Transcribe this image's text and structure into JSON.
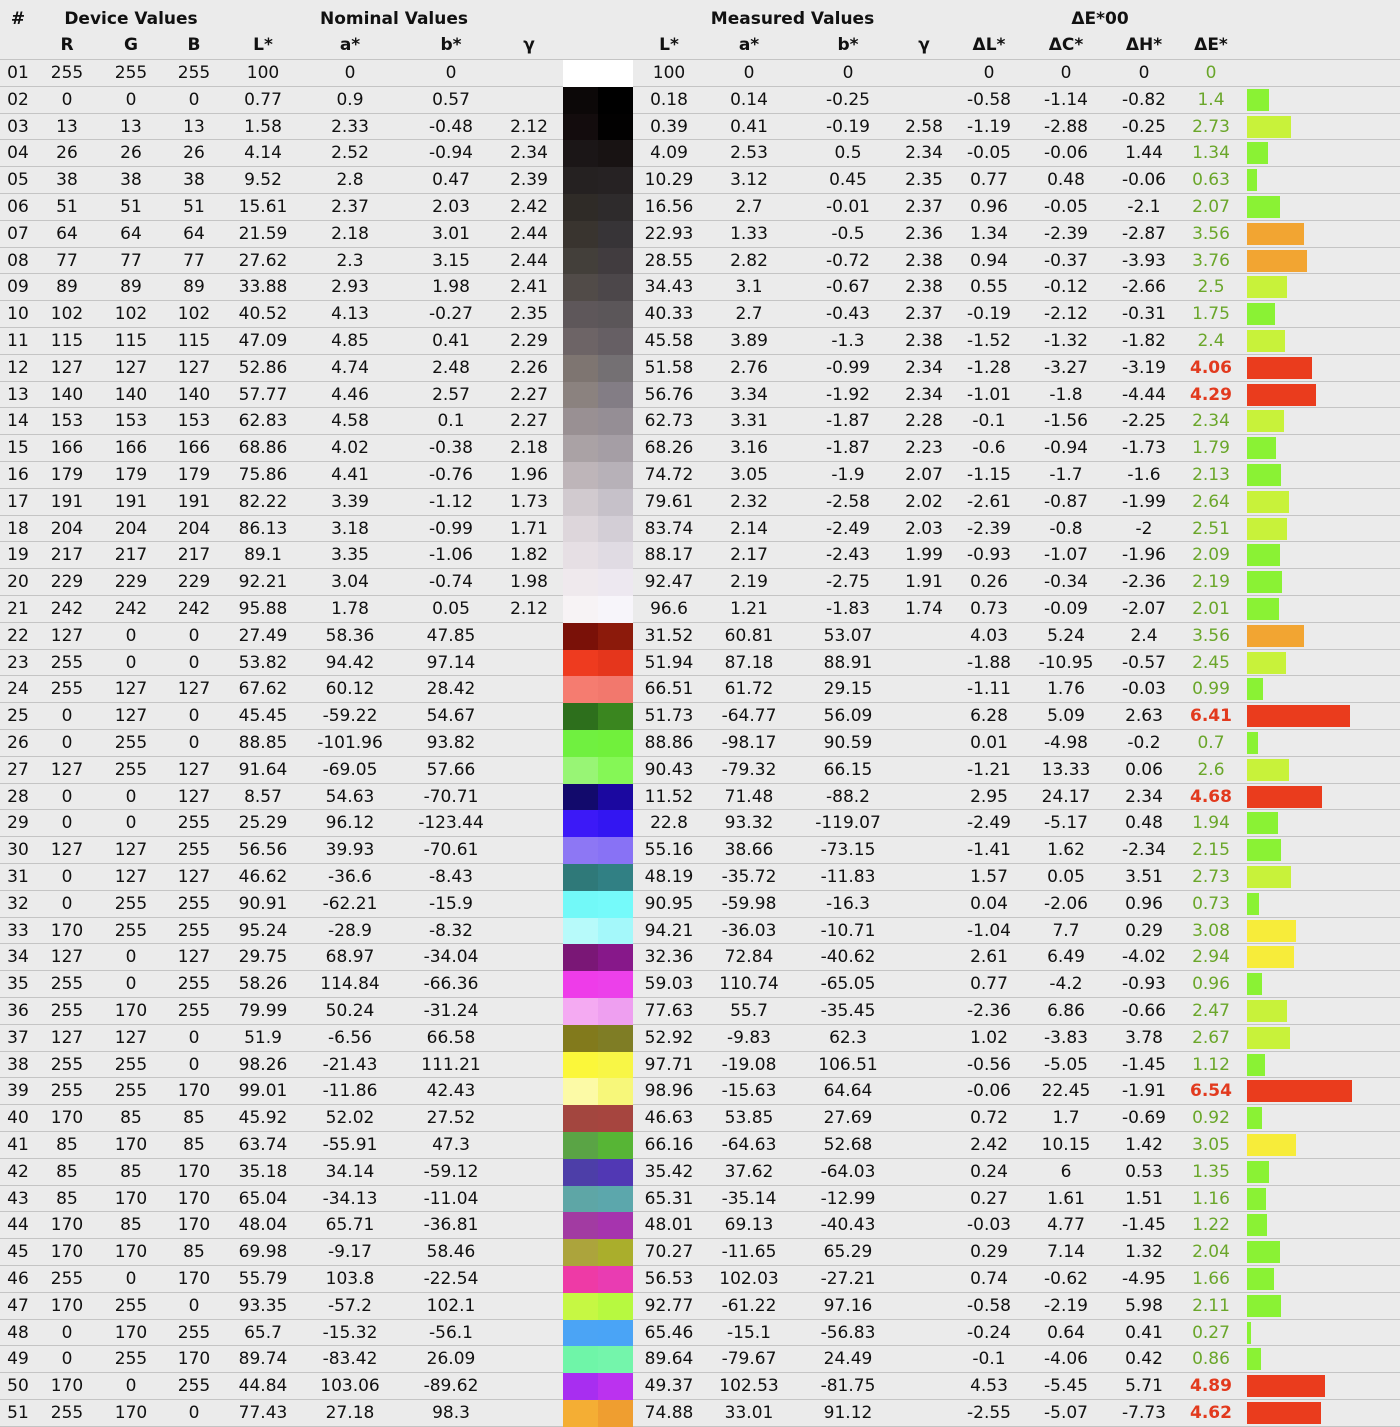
{
  "header": {
    "group_row": [
      "#",
      "Device Values",
      "Nominal Values",
      "Measured Values",
      "ΔE*00"
    ],
    "columns": [
      "R",
      "G",
      "B",
      "L*",
      "a*",
      "b*",
      "γ",
      "L*",
      "a*",
      "b*",
      "γ",
      "ΔL*",
      "ΔC*",
      "ΔH*",
      "ΔE*"
    ]
  },
  "colors": {
    "de_good": "#6aa62a",
    "de_bad": "#e23a1e",
    "bar_green": "#8af234",
    "bar_lime": "#c8f23a",
    "bar_yellow": "#f7ec3a",
    "bar_orange": "#f2a532",
    "bar_red": "#ea3c1d"
  },
  "rows": [
    {
      "id": "01",
      "r": "255",
      "g": "255",
      "b": "255",
      "nl": "100",
      "na": "0",
      "nb": "0",
      "ng": "",
      "ml": "100",
      "ma": "0",
      "mb": "0",
      "mg": "",
      "dl": "0",
      "dc": "0",
      "dh": "0",
      "de": "0",
      "sa": "#ffffff",
      "sb": "#ffffff"
    },
    {
      "id": "02",
      "r": "0",
      "g": "0",
      "b": "0",
      "nl": "0.77",
      "na": "0.9",
      "nb": "0.57",
      "ng": "",
      "ml": "0.18",
      "ma": "0.14",
      "mb": "-0.25",
      "mg": "",
      "dl": "-0.58",
      "dc": "-1.14",
      "dh": "-0.82",
      "de": "1.4",
      "sa": "#0c0808",
      "sb": "#000000"
    },
    {
      "id": "03",
      "r": "13",
      "g": "13",
      "b": "13",
      "nl": "1.58",
      "na": "2.33",
      "nb": "-0.48",
      "ng": "2.12",
      "ml": "0.39",
      "ma": "0.41",
      "mb": "-0.19",
      "mg": "2.58",
      "dl": "-1.19",
      "dc": "-2.88",
      "dh": "-0.25",
      "de": "2.73",
      "sa": "#130c0d",
      "sb": "#020101"
    },
    {
      "id": "04",
      "r": "26",
      "g": "26",
      "b": "26",
      "nl": "4.14",
      "na": "2.52",
      "nb": "-0.94",
      "ng": "2.34",
      "ml": "4.09",
      "ma": "2.53",
      "mb": "0.5",
      "mg": "2.34",
      "dl": "-0.05",
      "dc": "-0.06",
      "dh": "1.44",
      "de": "1.34",
      "sa": "#1b1617",
      "sb": "#181313"
    },
    {
      "id": "05",
      "r": "38",
      "g": "38",
      "b": "38",
      "nl": "9.52",
      "na": "2.8",
      "nb": "0.47",
      "ng": "2.39",
      "ml": "10.29",
      "ma": "3.12",
      "mb": "0.45",
      "mg": "2.35",
      "dl": "0.77",
      "dc": "0.48",
      "dh": "-0.06",
      "de": "0.63",
      "sa": "#252121",
      "sb": "#262223"
    },
    {
      "id": "06",
      "r": "51",
      "g": "51",
      "b": "51",
      "nl": "15.61",
      "na": "2.37",
      "nb": "2.03",
      "ng": "2.42",
      "ml": "16.56",
      "ma": "2.7",
      "mb": "-0.01",
      "mg": "2.37",
      "dl": "0.96",
      "dc": "-0.05",
      "dh": "-2.1",
      "de": "2.07",
      "sa": "#2f2b27",
      "sb": "#2e2b2c"
    },
    {
      "id": "07",
      "r": "64",
      "g": "64",
      "b": "64",
      "nl": "21.59",
      "na": "2.18",
      "nb": "3.01",
      "ng": "2.44",
      "ml": "22.93",
      "ma": "1.33",
      "mb": "-0.5",
      "mg": "2.36",
      "dl": "1.34",
      "dc": "-2.39",
      "dh": "-2.87",
      "de": "3.56",
      "sa": "#39342f",
      "sb": "#373437"
    },
    {
      "id": "08",
      "r": "77",
      "g": "77",
      "b": "77",
      "nl": "27.62",
      "na": "2.3",
      "nb": "3.15",
      "ng": "2.44",
      "ml": "28.55",
      "ma": "2.82",
      "mb": "-0.72",
      "mg": "2.38",
      "dl": "0.94",
      "dc": "-0.37",
      "dh": "-3.93",
      "de": "3.76",
      "sa": "#433f3a",
      "sb": "#413c3f"
    },
    {
      "id": "09",
      "r": "89",
      "g": "89",
      "b": "89",
      "nl": "33.88",
      "na": "2.93",
      "nb": "1.98",
      "ng": "2.41",
      "ml": "34.43",
      "ma": "3.1",
      "mb": "-0.67",
      "mg": "2.38",
      "dl": "0.55",
      "dc": "-0.12",
      "dh": "-2.66",
      "de": "2.5",
      "sa": "#514b48",
      "sb": "#4c474a"
    },
    {
      "id": "10",
      "r": "102",
      "g": "102",
      "b": "102",
      "nl": "40.52",
      "na": "4.13",
      "nb": "-0.27",
      "ng": "2.35",
      "ml": "40.33",
      "ma": "2.7",
      "mb": "-0.43",
      "mg": "2.37",
      "dl": "-0.19",
      "dc": "-2.12",
      "dh": "-0.31",
      "de": "1.75",
      "sa": "#5e575a",
      "sb": "#5b5659"
    },
    {
      "id": "11",
      "r": "115",
      "g": "115",
      "b": "115",
      "nl": "47.09",
      "na": "4.85",
      "nb": "0.41",
      "ng": "2.29",
      "ml": "45.58",
      "ma": "3.89",
      "mb": "-1.3",
      "mg": "2.38",
      "dl": "-1.52",
      "dc": "-1.32",
      "dh": "-1.82",
      "de": "2.4",
      "sa": "#6d6466",
      "sb": "#665f64"
    },
    {
      "id": "12",
      "r": "127",
      "g": "127",
      "b": "127",
      "nl": "52.86",
      "na": "4.74",
      "nb": "2.48",
      "ng": "2.26",
      "ml": "51.58",
      "ma": "2.76",
      "mb": "-0.99",
      "mg": "2.34",
      "dl": "-1.28",
      "dc": "-3.27",
      "dh": "-3.19",
      "de": "4.06",
      "sa": "#7e7571",
      "sb": "#747073"
    },
    {
      "id": "13",
      "r": "140",
      "g": "140",
      "b": "140",
      "nl": "57.77",
      "na": "4.46",
      "nb": "2.57",
      "ng": "2.27",
      "ml": "56.76",
      "ma": "3.34",
      "mb": "-1.92",
      "mg": "2.34",
      "dl": "-1.01",
      "dc": "-1.8",
      "dh": "-4.44",
      "de": "4.29",
      "sa": "#8b827f",
      "sb": "#837d85"
    },
    {
      "id": "14",
      "r": "153",
      "g": "153",
      "b": "153",
      "nl": "62.83",
      "na": "4.58",
      "nb": "0.1",
      "ng": "2.27",
      "ml": "62.73",
      "ma": "3.31",
      "mb": "-1.87",
      "mg": "2.28",
      "dl": "-0.1",
      "dc": "-1.56",
      "dh": "-2.25",
      "de": "2.34",
      "sa": "#999093",
      "sb": "#958e95"
    },
    {
      "id": "15",
      "r": "166",
      "g": "166",
      "b": "166",
      "nl": "68.86",
      "na": "4.02",
      "nb": "-0.38",
      "ng": "2.18",
      "ml": "68.26",
      "ma": "3.16",
      "mb": "-1.87",
      "mg": "2.23",
      "dl": "-0.6",
      "dc": "-0.94",
      "dh": "-1.73",
      "de": "1.79",
      "sa": "#aaa2a5",
      "sb": "#a59ea5"
    },
    {
      "id": "16",
      "r": "179",
      "g": "179",
      "b": "179",
      "nl": "75.86",
      "na": "4.41",
      "nb": "-0.76",
      "ng": "1.96",
      "ml": "74.72",
      "ma": "3.05",
      "mb": "-1.9",
      "mg": "2.07",
      "dl": "-1.15",
      "dc": "-1.7",
      "dh": "-1.6",
      "de": "2.13",
      "sa": "#beb5b9",
      "sb": "#b7b1b8"
    },
    {
      "id": "17",
      "r": "191",
      "g": "191",
      "b": "191",
      "nl": "82.22",
      "na": "3.39",
      "nb": "-1.12",
      "ng": "1.73",
      "ml": "79.61",
      "ma": "2.32",
      "mb": "-2.58",
      "mg": "2.02",
      "dl": "-2.61",
      "dc": "-0.87",
      "dh": "-1.99",
      "de": "2.64",
      "sa": "#d1cacf",
      "sb": "#c6c1c9"
    },
    {
      "id": "18",
      "r": "204",
      "g": "204",
      "b": "204",
      "nl": "86.13",
      "na": "3.18",
      "nb": "-0.99",
      "ng": "1.71",
      "ml": "83.74",
      "ma": "2.14",
      "mb": "-2.49",
      "mg": "2.03",
      "dl": "-2.39",
      "dc": "-0.8",
      "dh": "-2",
      "de": "2.51",
      "sa": "#ddd6db",
      "sb": "#d3ced6"
    },
    {
      "id": "19",
      "r": "217",
      "g": "217",
      "b": "217",
      "nl": "89.1",
      "na": "3.35",
      "nb": "-1.06",
      "ng": "1.82",
      "ml": "88.17",
      "ma": "2.17",
      "mb": "-2.43",
      "mg": "1.99",
      "dl": "-0.93",
      "dc": "-1.07",
      "dh": "-1.96",
      "de": "2.09",
      "sa": "#e6dfe4",
      "sb": "#e0dbe3"
    },
    {
      "id": "20",
      "r": "229",
      "g": "229",
      "b": "229",
      "nl": "92.21",
      "na": "3.04",
      "nb": "-0.74",
      "ng": "1.98",
      "ml": "92.47",
      "ma": "2.19",
      "mb": "-2.75",
      "mg": "1.91",
      "dl": "0.26",
      "dc": "-0.34",
      "dh": "-2.36",
      "de": "2.19",
      "sa": "#efe9ed",
      "sb": "#ede8f0"
    },
    {
      "id": "21",
      "r": "242",
      "g": "242",
      "b": "242",
      "nl": "95.88",
      "na": "1.78",
      "nb": "0.05",
      "ng": "2.12",
      "ml": "96.6",
      "ma": "1.21",
      "mb": "-1.83",
      "mg": "1.74",
      "dl": "0.73",
      "dc": "-0.09",
      "dh": "-2.07",
      "de": "2.01",
      "sa": "#f7f3f5",
      "sb": "#f7f5fa"
    },
    {
      "id": "22",
      "r": "127",
      "g": "0",
      "b": "0",
      "nl": "27.49",
      "na": "58.36",
      "nb": "47.85",
      "ng": "",
      "ml": "31.52",
      "ma": "60.81",
      "mb": "53.07",
      "mg": "",
      "dl": "4.03",
      "dc": "5.24",
      "dh": "2.4",
      "de": "3.56",
      "sa": "#7a1108",
      "sb": "#8c1a0b"
    },
    {
      "id": "23",
      "r": "255",
      "g": "0",
      "b": "0",
      "nl": "53.82",
      "na": "94.42",
      "nb": "97.14",
      "ng": "",
      "ml": "51.94",
      "ma": "87.18",
      "mb": "88.91",
      "mg": "",
      "dl": "-1.88",
      "dc": "-10.95",
      "dh": "-0.57",
      "de": "2.45",
      "sa": "#ee3b1f",
      "sb": "#e5361c"
    },
    {
      "id": "24",
      "r": "255",
      "g": "127",
      "b": "127",
      "nl": "67.62",
      "na": "60.12",
      "nb": "28.42",
      "ng": "",
      "ml": "66.51",
      "ma": "61.72",
      "mb": "29.15",
      "mg": "",
      "dl": "-1.11",
      "dc": "1.76",
      "dh": "-0.03",
      "de": "0.99",
      "sa": "#f57c70",
      "sb": "#f2786d"
    },
    {
      "id": "25",
      "r": "0",
      "g": "127",
      "b": "0",
      "nl": "45.45",
      "na": "-59.22",
      "nb": "54.67",
      "ng": "",
      "ml": "51.73",
      "ma": "-64.77",
      "mb": "56.09",
      "mg": "",
      "dl": "6.28",
      "dc": "5.09",
      "dh": "2.63",
      "de": "6.41",
      "sa": "#2d6f1c",
      "sb": "#3a861f"
    },
    {
      "id": "26",
      "r": "0",
      "g": "255",
      "b": "0",
      "nl": "88.85",
      "na": "-101.96",
      "nb": "93.82",
      "ng": "",
      "ml": "88.86",
      "ma": "-98.17",
      "mb": "90.59",
      "mg": "",
      "dl": "0.01",
      "dc": "-4.98",
      "dh": "-0.2",
      "de": "0.7",
      "sa": "#70f040",
      "sb": "#71f03c"
    },
    {
      "id": "27",
      "r": "127",
      "g": "255",
      "b": "127",
      "nl": "91.64",
      "na": "-69.05",
      "nb": "57.66",
      "ng": "",
      "ml": "90.43",
      "ma": "-79.32",
      "mb": "66.15",
      "mg": "",
      "dl": "-1.21",
      "dc": "13.33",
      "dh": "0.06",
      "de": "2.6",
      "sa": "#98f575",
      "sb": "#85f756"
    },
    {
      "id": "28",
      "r": "0",
      "g": "0",
      "b": "127",
      "nl": "8.57",
      "na": "54.63",
      "nb": "-70.71",
      "ng": "",
      "ml": "11.52",
      "ma": "71.48",
      "mb": "-88.2",
      "mg": "",
      "dl": "2.95",
      "dc": "24.17",
      "dh": "2.34",
      "de": "4.68",
      "sa": "#120a6c",
      "sb": "#1b08a0"
    },
    {
      "id": "29",
      "r": "0",
      "g": "0",
      "b": "255",
      "nl": "25.29",
      "na": "96.12",
      "nb": "-123.44",
      "ng": "",
      "ml": "22.8",
      "ma": "93.32",
      "mb": "-119.07",
      "mg": "",
      "dl": "-2.49",
      "dc": "-5.17",
      "dh": "0.48",
      "de": "1.94",
      "sa": "#3c19f7",
      "sb": "#3316f2"
    },
    {
      "id": "30",
      "r": "127",
      "g": "127",
      "b": "255",
      "nl": "56.56",
      "na": "39.93",
      "nb": "-70.61",
      "ng": "",
      "ml": "55.16",
      "ma": "38.66",
      "mb": "-73.15",
      "mg": "",
      "dl": "-1.41",
      "dc": "1.62",
      "dh": "-2.34",
      "de": "2.15",
      "sa": "#8d77f4",
      "sb": "#8872f5"
    },
    {
      "id": "31",
      "r": "0",
      "g": "127",
      "b": "127",
      "nl": "46.62",
      "na": "-36.6",
      "nb": "-8.43",
      "ng": "",
      "ml": "48.19",
      "ma": "-35.72",
      "mb": "-11.83",
      "mg": "",
      "dl": "1.57",
      "dc": "0.05",
      "dh": "3.51",
      "de": "2.73",
      "sa": "#2f7979",
      "sb": "#318084"
    },
    {
      "id": "32",
      "r": "0",
      "g": "255",
      "b": "255",
      "nl": "90.91",
      "na": "-62.21",
      "nb": "-15.9",
      "ng": "",
      "ml": "90.95",
      "ma": "-59.98",
      "mb": "-16.3",
      "mg": "",
      "dl": "0.04",
      "dc": "-2.06",
      "dh": "0.96",
      "de": "0.73",
      "sa": "#72f9f8",
      "sb": "#75fafa"
    },
    {
      "id": "33",
      "r": "170",
      "g": "255",
      "b": "255",
      "nl": "95.24",
      "na": "-28.9",
      "nb": "-8.32",
      "ng": "",
      "ml": "94.21",
      "ma": "-36.03",
      "mb": "-10.71",
      "mg": "",
      "dl": "-1.04",
      "dc": "7.7",
      "dh": "0.29",
      "de": "3.08",
      "sa": "#b7fafa",
      "sb": "#a4f8fa"
    },
    {
      "id": "34",
      "r": "127",
      "g": "0",
      "b": "127",
      "nl": "29.75",
      "na": "68.97",
      "nb": "-34.04",
      "ng": "",
      "ml": "32.36",
      "ma": "72.84",
      "mb": "-40.62",
      "mg": "",
      "dl": "2.61",
      "dc": "6.49",
      "dh": "-4.02",
      "de": "2.94",
      "sa": "#7a1776",
      "sb": "#87188a"
    },
    {
      "id": "35",
      "r": "255",
      "g": "0",
      "b": "255",
      "nl": "58.26",
      "na": "114.84",
      "nb": "-66.36",
      "ng": "",
      "ml": "59.03",
      "ma": "110.74",
      "mb": "-65.05",
      "mg": "",
      "dl": "0.77",
      "dc": "-4.2",
      "dh": "-0.93",
      "de": "0.96",
      "sa": "#ee3ce9",
      "sb": "#ec40ea"
    },
    {
      "id": "36",
      "r": "255",
      "g": "170",
      "b": "255",
      "nl": "79.99",
      "na": "50.24",
      "nb": "-31.24",
      "ng": "",
      "ml": "77.63",
      "ma": "55.7",
      "mb": "-35.45",
      "mg": "",
      "dl": "-2.36",
      "dc": "6.86",
      "dh": "-0.66",
      "de": "2.47",
      "sa": "#f4aaf2",
      "sb": "#ee9ff0"
    },
    {
      "id": "37",
      "r": "127",
      "g": "127",
      "b": "0",
      "nl": "51.9",
      "na": "-6.56",
      "nb": "66.58",
      "ng": "",
      "ml": "52.92",
      "ma": "-9.83",
      "mb": "62.3",
      "mg": "",
      "dl": "1.02",
      "dc": "-3.83",
      "dh": "3.78",
      "de": "2.67",
      "sa": "#827a1c",
      "sb": "#7f7d25"
    },
    {
      "id": "38",
      "r": "255",
      "g": "255",
      "b": "0",
      "nl": "98.26",
      "na": "-21.43",
      "nb": "111.21",
      "ng": "",
      "ml": "97.71",
      "ma": "-19.08",
      "mb": "106.51",
      "mg": "",
      "dl": "-0.56",
      "dc": "-5.05",
      "dh": "-1.45",
      "de": "1.12",
      "sa": "#fbf73a",
      "sb": "#f8f646"
    },
    {
      "id": "39",
      "r": "255",
      "g": "255",
      "b": "170",
      "nl": "99.01",
      "na": "-11.86",
      "nb": "42.43",
      "ng": "",
      "ml": "98.96",
      "ma": "-15.63",
      "mb": "64.64",
      "mg": "",
      "dl": "-0.06",
      "dc": "22.45",
      "dh": "-1.91",
      "de": "6.54",
      "sa": "#fcfaa6",
      "sb": "#f7f77a"
    },
    {
      "id": "40",
      "r": "170",
      "g": "85",
      "b": "85",
      "nl": "45.92",
      "na": "52.02",
      "nb": "27.52",
      "ng": "",
      "ml": "46.63",
      "ma": "53.85",
      "mb": "27.69",
      "mg": "",
      "dl": "0.72",
      "dc": "1.7",
      "dh": "-0.69",
      "de": "0.92",
      "sa": "#a3463f",
      "sb": "#a6453f"
    },
    {
      "id": "41",
      "r": "85",
      "g": "170",
      "b": "85",
      "nl": "63.74",
      "na": "-55.91",
      "nb": "47.3",
      "ng": "",
      "ml": "66.16",
      "ma": "-64.63",
      "mb": "52.68",
      "mg": "",
      "dl": "2.42",
      "dc": "10.15",
      "dh": "1.42",
      "de": "3.05",
      "sa": "#5aa445",
      "sb": "#57b535"
    },
    {
      "id": "42",
      "r": "85",
      "g": "85",
      "b": "170",
      "nl": "35.18",
      "na": "34.14",
      "nb": "-59.12",
      "ng": "",
      "ml": "35.42",
      "ma": "37.62",
      "mb": "-64.03",
      "mg": "",
      "dl": "0.24",
      "dc": "6",
      "dh": "0.53",
      "de": "1.35",
      "sa": "#4d3ea8",
      "sb": "#5138b4"
    },
    {
      "id": "43",
      "r": "85",
      "g": "170",
      "b": "170",
      "nl": "65.04",
      "na": "-34.13",
      "nb": "-11.04",
      "ng": "",
      "ml": "65.31",
      "ma": "-35.14",
      "mb": "-12.99",
      "mg": "",
      "dl": "0.27",
      "dc": "1.61",
      "dh": "1.51",
      "de": "1.16",
      "sa": "#5ea6a6",
      "sb": "#5ca7ac"
    },
    {
      "id": "44",
      "r": "170",
      "g": "85",
      "b": "170",
      "nl": "48.04",
      "na": "65.71",
      "nb": "-36.81",
      "ng": "",
      "ml": "48.01",
      "ma": "69.13",
      "mb": "-40.43",
      "mg": "",
      "dl": "-0.03",
      "dc": "4.77",
      "dh": "-1.45",
      "de": "1.22",
      "sa": "#a23ba2",
      "sb": "#a634ae"
    },
    {
      "id": "45",
      "r": "170",
      "g": "170",
      "b": "85",
      "nl": "69.98",
      "na": "-9.17",
      "nb": "58.46",
      "ng": "",
      "ml": "70.27",
      "ma": "-11.65",
      "mb": "65.29",
      "mg": "",
      "dl": "0.29",
      "dc": "7.14",
      "dh": "1.32",
      "de": "2.04",
      "sa": "#aca43c",
      "sb": "#aaae2c"
    },
    {
      "id": "46",
      "r": "255",
      "g": "0",
      "b": "170",
      "nl": "55.79",
      "na": "103.8",
      "nb": "-22.54",
      "ng": "",
      "ml": "56.53",
      "ma": "102.03",
      "mb": "-27.21",
      "mg": "",
      "dl": "0.74",
      "dc": "-0.62",
      "dh": "-4.95",
      "de": "1.66",
      "sa": "#ee3aa6",
      "sb": "#e93cb2"
    },
    {
      "id": "47",
      "r": "170",
      "g": "255",
      "b": "0",
      "nl": "93.35",
      "na": "-57.2",
      "nb": "102.1",
      "ng": "",
      "ml": "92.77",
      "ma": "-61.22",
      "mb": "97.16",
      "mg": "",
      "dl": "-0.58",
      "dc": "-2.19",
      "dh": "5.98",
      "de": "2.11",
      "sa": "#c6f843",
      "sb": "#b7f940"
    },
    {
      "id": "48",
      "r": "0",
      "g": "170",
      "b": "255",
      "nl": "65.7",
      "na": "-15.32",
      "nb": "-56.1",
      "ng": "",
      "ml": "65.46",
      "ma": "-15.1",
      "mb": "-56.83",
      "mg": "",
      "dl": "-0.24",
      "dc": "0.64",
      "dh": "0.41",
      "de": "0.27",
      "sa": "#4ba4f5",
      "sb": "#4aa4f6"
    },
    {
      "id": "49",
      "r": "0",
      "g": "255",
      "b": "170",
      "nl": "89.74",
      "na": "-83.42",
      "nb": "26.09",
      "ng": "",
      "ml": "89.64",
      "ma": "-79.67",
      "mb": "24.49",
      "mg": "",
      "dl": "-0.1",
      "dc": "-4.06",
      "dh": "0.42",
      "de": "0.86",
      "sa": "#6ff5a8",
      "sb": "#74f5ab"
    },
    {
      "id": "50",
      "r": "170",
      "g": "0",
      "b": "255",
      "nl": "44.84",
      "na": "103.06",
      "nb": "-89.62",
      "ng": "",
      "ml": "49.37",
      "ma": "102.53",
      "mb": "-81.75",
      "mg": "",
      "dl": "4.53",
      "dc": "-5.45",
      "dh": "5.71",
      "de": "4.89",
      "sa": "#a82ef0",
      "sb": "#bb32ef"
    },
    {
      "id": "51",
      "r": "255",
      "g": "170",
      "b": "0",
      "nl": "77.43",
      "na": "27.18",
      "nb": "98.3",
      "ng": "",
      "ml": "74.88",
      "ma": "33.01",
      "mb": "91.12",
      "mg": "",
      "dl": "-2.55",
      "dc": "-5.07",
      "dh": "-7.73",
      "de": "4.62",
      "sa": "#f4ae34",
      "sb": "#ef9e30"
    }
  ]
}
